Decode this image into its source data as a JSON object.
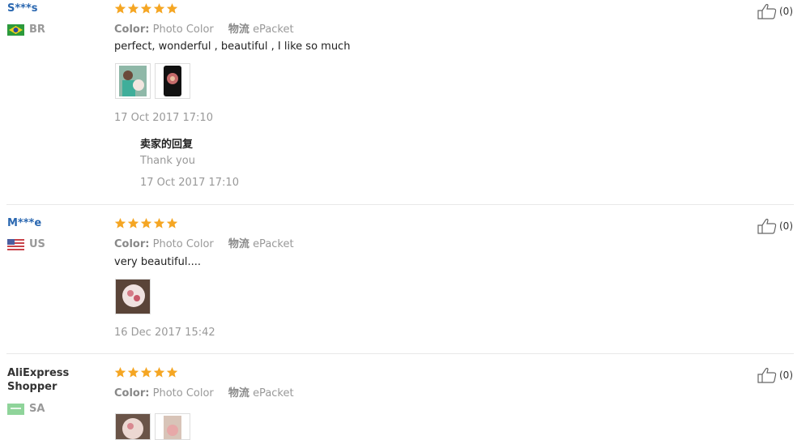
{
  "labels": {
    "color": "Color:",
    "shipping": "物流"
  },
  "reviews": [
    {
      "name": "S***s",
      "country": "BR",
      "rating": 5,
      "color": "Photo Color",
      "shipping": "ePacket",
      "text": "perfect, wonderful , beautiful , I like so much",
      "date": "17 Oct 2017 17:10",
      "reply": {
        "title": "卖家的回复",
        "text": "Thank you",
        "date": "17 Oct 2017 17:10"
      },
      "helpful": "(0)"
    },
    {
      "name": "M***e",
      "country": "US",
      "rating": 5,
      "color": "Photo Color",
      "shipping": "ePacket",
      "text": "very beautiful....",
      "date": "16 Dec 2017 15:42",
      "helpful": "(0)"
    },
    {
      "name": "AliExpress Shopper",
      "country": "SA",
      "rating": 5,
      "color": "Photo Color",
      "shipping": "ePacket",
      "helpful": "(0)"
    }
  ],
  "colors": {
    "star": "#f5a623",
    "name": "#2a67b0",
    "muted": "#999999"
  },
  "icons": {
    "star": "star-icon",
    "helpful": "thumbs-up-icon"
  }
}
